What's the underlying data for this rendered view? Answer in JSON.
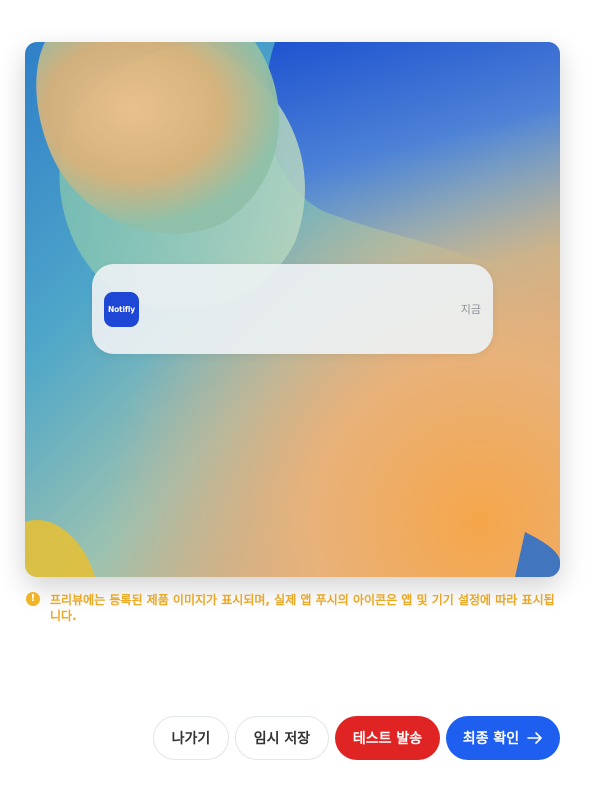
{
  "preview": {
    "notification": {
      "app_icon_label": "Notifly",
      "time": "지금"
    }
  },
  "notice": {
    "icon": "warning-icon",
    "text": "프리뷰에는 등록된 제품 이미지가 표시되며, 실제 앱 푸시의 아이콘은 앱 및 기기 설정에 따라 표시됩니다."
  },
  "actions": {
    "exit_label": "나가기",
    "draft_label": "임시 저장",
    "test_label": "테스트 발송",
    "final_label": "최종 확인",
    "final_icon": "arrow-right-icon"
  },
  "colors": {
    "test_button": "#e02424",
    "final_button": "#1e5ff0",
    "notice_text": "#eaa827",
    "app_icon_bg": "#1f47d6"
  }
}
